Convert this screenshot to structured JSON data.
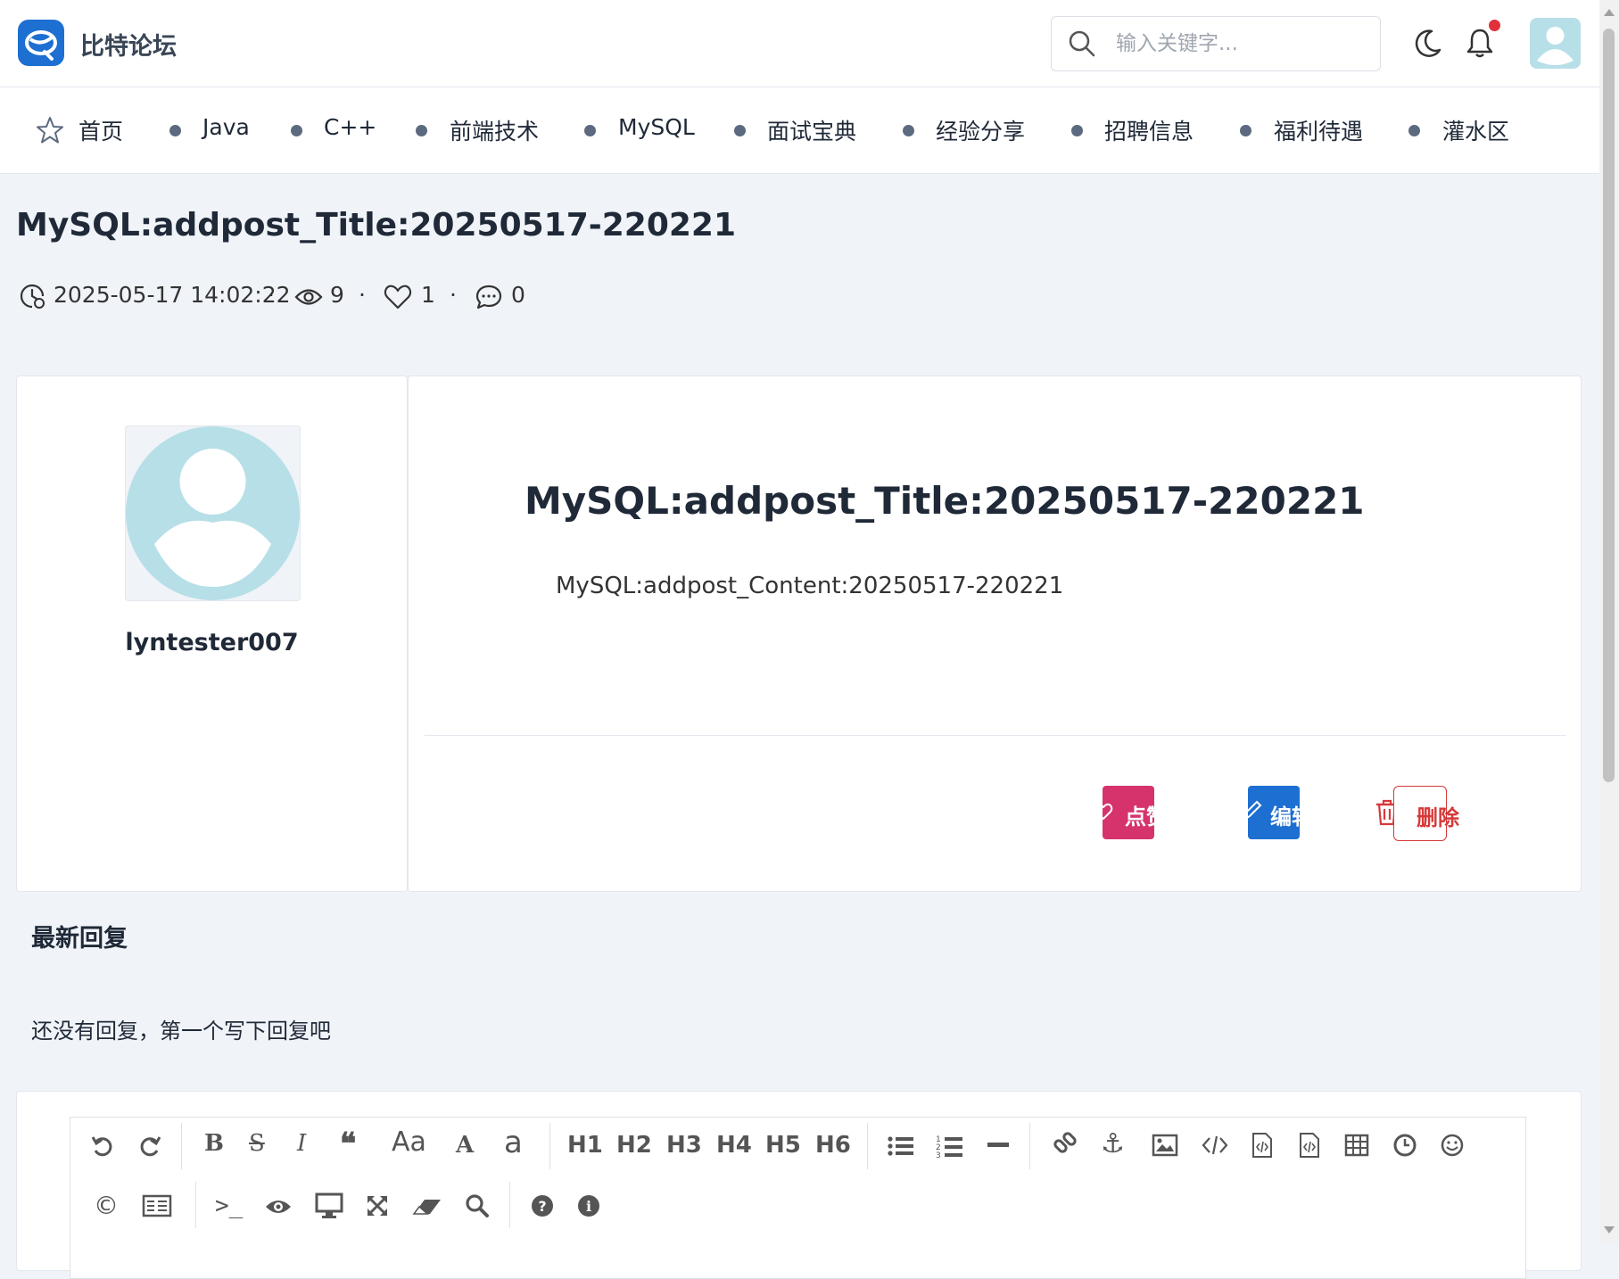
{
  "header": {
    "brand": "比特论坛",
    "search_placeholder": "输入关键字...",
    "icons": [
      "logo-icon",
      "search-icon",
      "moon-icon",
      "bell-icon",
      "avatar"
    ],
    "notification_dot_color": "#e0303a"
  },
  "nav": {
    "items": [
      {
        "label": "首页",
        "icon": "star-icon"
      },
      {
        "label": "Java"
      },
      {
        "label": "C++"
      },
      {
        "label": "前端技术"
      },
      {
        "label": "MySQL"
      },
      {
        "label": "面试宝典"
      },
      {
        "label": "经验分享"
      },
      {
        "label": "招聘信息"
      },
      {
        "label": "福利待遇"
      },
      {
        "label": "灌水区"
      }
    ]
  },
  "post": {
    "title": "MySQL:addpost_Title:20250517-220221",
    "meta": {
      "time": "2025-05-17 14:02:22",
      "views": "9",
      "likes": "1",
      "comments": "0",
      "sep": "·"
    },
    "author": "lyntester007",
    "content_title": "MySQL:addpost_Title:20250517-220221",
    "content_body": "MySQL:addpost_Content:20250517-220221",
    "buttons": {
      "like": "点赞",
      "edit": "编辑",
      "delete": "删除"
    }
  },
  "replies": {
    "heading": "最新回复",
    "empty_text": "还没有回复，第一个写下回复吧"
  },
  "editor": {
    "toolbar_row1": [
      "undo-icon",
      "redo-icon",
      "bold-icon",
      "strikethrough-icon",
      "italic-icon",
      "quote-icon",
      "uppercase-icon",
      "uppercase-first-icon",
      "lowercase-icon",
      "H1",
      "H2",
      "H3",
      "H4",
      "H5",
      "H6",
      "unordered-list-icon",
      "ordered-list-icon",
      "hr-icon",
      "link-icon",
      "anchor-icon",
      "image-icon",
      "code-icon",
      "code-block-icon",
      "code-file-icon",
      "table-icon",
      "datetime-icon",
      "emoji-icon"
    ],
    "toolbar_row2": [
      "html-entities-icon",
      "pagebreak-icon",
      "terminal-icon",
      "preview-icon",
      "desktop-icon",
      "fullscreen-icon",
      "clear-icon",
      "search-icon",
      "help-icon",
      "info-icon"
    ],
    "headings": {
      "h1": "H1",
      "h2": "H2",
      "h3": "H3",
      "h4": "H4",
      "h5": "H5",
      "h6": "H6"
    },
    "case_labels": {
      "upper": "Aa",
      "a_big": "A",
      "a_small": "a"
    }
  }
}
